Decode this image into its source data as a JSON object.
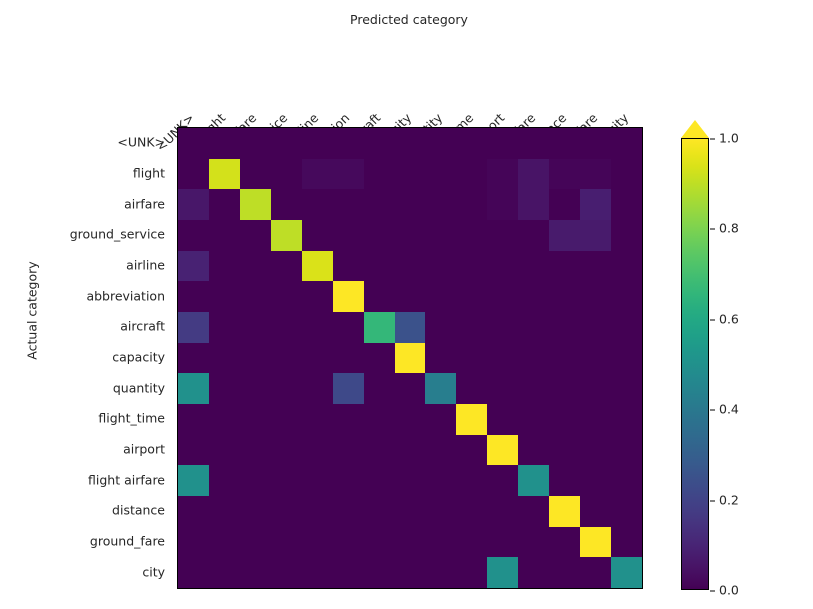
{
  "figure": {
    "background": "#ffffff",
    "xaxis_title": "Predicted category",
    "yaxis_title": "Actual category"
  },
  "colorbar": {
    "colormap": "viridis",
    "vmin": 0.0,
    "vmax": 1.0,
    "extend": "max",
    "ticks": [
      {
        "value": 1.0,
        "label": "1.0"
      },
      {
        "value": 0.8,
        "label": "0.8"
      },
      {
        "value": 0.6,
        "label": "0.6"
      },
      {
        "value": 0.4,
        "label": "0.4"
      },
      {
        "value": 0.2,
        "label": "0.2"
      },
      {
        "value": 0.0,
        "label": "0.0"
      }
    ]
  },
  "chart_data": {
    "type": "heatmap",
    "title": "",
    "xlabel": "Predicted category",
    "ylabel": "Actual category",
    "colormap": "viridis",
    "zlim": [
      0.0,
      1.0
    ],
    "grid": false,
    "legend": "colorbar-right",
    "xticklabels": [
      "<UNK>",
      "flight",
      "airfare",
      "ground_service",
      "airline",
      "abbreviation",
      "aircraft",
      "capacity",
      "quantity",
      "flight_time",
      "airport",
      "flight airfare",
      "distance",
      "ground_fare",
      "city"
    ],
    "yticklabels": [
      "<UNK>",
      "flight",
      "airfare",
      "ground_service",
      "airline",
      "abbreviation",
      "aircraft",
      "capacity",
      "quantity",
      "flight_time",
      "airport",
      "flight airfare",
      "distance",
      "ground_fare",
      "city"
    ],
    "values": [
      [
        0.0,
        0.0,
        0.0,
        0.0,
        0.0,
        0.0,
        0.0,
        0.0,
        0.0,
        0.0,
        0.0,
        0.0,
        0.0,
        0.0,
        0.0
      ],
      [
        0.0,
        0.93,
        0.0,
        0.0,
        0.02,
        0.02,
        0.0,
        0.0,
        0.0,
        0.0,
        0.01,
        0.05,
        0.01,
        0.01,
        0.0
      ],
      [
        0.06,
        0.0,
        0.9,
        0.0,
        0.0,
        0.0,
        0.0,
        0.0,
        0.0,
        0.0,
        0.01,
        0.05,
        0.0,
        0.08,
        0.0
      ],
      [
        0.0,
        0.0,
        0.0,
        0.9,
        0.0,
        0.0,
        0.0,
        0.0,
        0.0,
        0.0,
        0.0,
        0.0,
        0.07,
        0.07,
        0.0
      ],
      [
        0.09,
        0.0,
        0.0,
        0.0,
        0.94,
        0.0,
        0.0,
        0.0,
        0.0,
        0.0,
        0.0,
        0.0,
        0.0,
        0.0,
        0.0
      ],
      [
        0.0,
        0.0,
        0.0,
        0.0,
        0.0,
        1.0,
        0.0,
        0.0,
        0.0,
        0.0,
        0.0,
        0.0,
        0.0,
        0.0,
        0.0
      ],
      [
        0.17,
        0.0,
        0.0,
        0.0,
        0.0,
        0.0,
        0.66,
        0.25,
        0.0,
        0.0,
        0.0,
        0.0,
        0.0,
        0.0,
        0.0
      ],
      [
        0.0,
        0.0,
        0.0,
        0.0,
        0.0,
        0.0,
        0.0,
        1.0,
        0.0,
        0.0,
        0.0,
        0.0,
        0.0,
        0.0,
        0.0
      ],
      [
        0.5,
        0.0,
        0.0,
        0.0,
        0.0,
        0.22,
        0.0,
        0.0,
        0.42,
        0.0,
        0.0,
        0.0,
        0.0,
        0.0,
        0.0
      ],
      [
        0.0,
        0.0,
        0.0,
        0.0,
        0.0,
        0.0,
        0.0,
        0.0,
        0.0,
        1.0,
        0.0,
        0.0,
        0.0,
        0.0,
        0.0
      ],
      [
        0.0,
        0.0,
        0.0,
        0.0,
        0.0,
        0.0,
        0.0,
        0.0,
        0.0,
        0.0,
        1.0,
        0.0,
        0.0,
        0.0,
        0.0
      ],
      [
        0.5,
        0.0,
        0.0,
        0.0,
        0.0,
        0.0,
        0.0,
        0.0,
        0.0,
        0.0,
        0.0,
        0.5,
        0.0,
        0.0,
        0.0
      ],
      [
        0.0,
        0.0,
        0.0,
        0.0,
        0.0,
        0.0,
        0.0,
        0.0,
        0.0,
        0.0,
        0.0,
        0.0,
        1.0,
        0.0,
        0.0
      ],
      [
        0.0,
        0.0,
        0.0,
        0.0,
        0.0,
        0.0,
        0.0,
        0.0,
        0.0,
        0.0,
        0.0,
        0.0,
        0.0,
        1.0,
        0.0
      ],
      [
        0.0,
        0.0,
        0.0,
        0.0,
        0.0,
        0.0,
        0.0,
        0.0,
        0.0,
        0.0,
        0.5,
        0.0,
        0.0,
        0.0,
        0.5
      ]
    ]
  }
}
